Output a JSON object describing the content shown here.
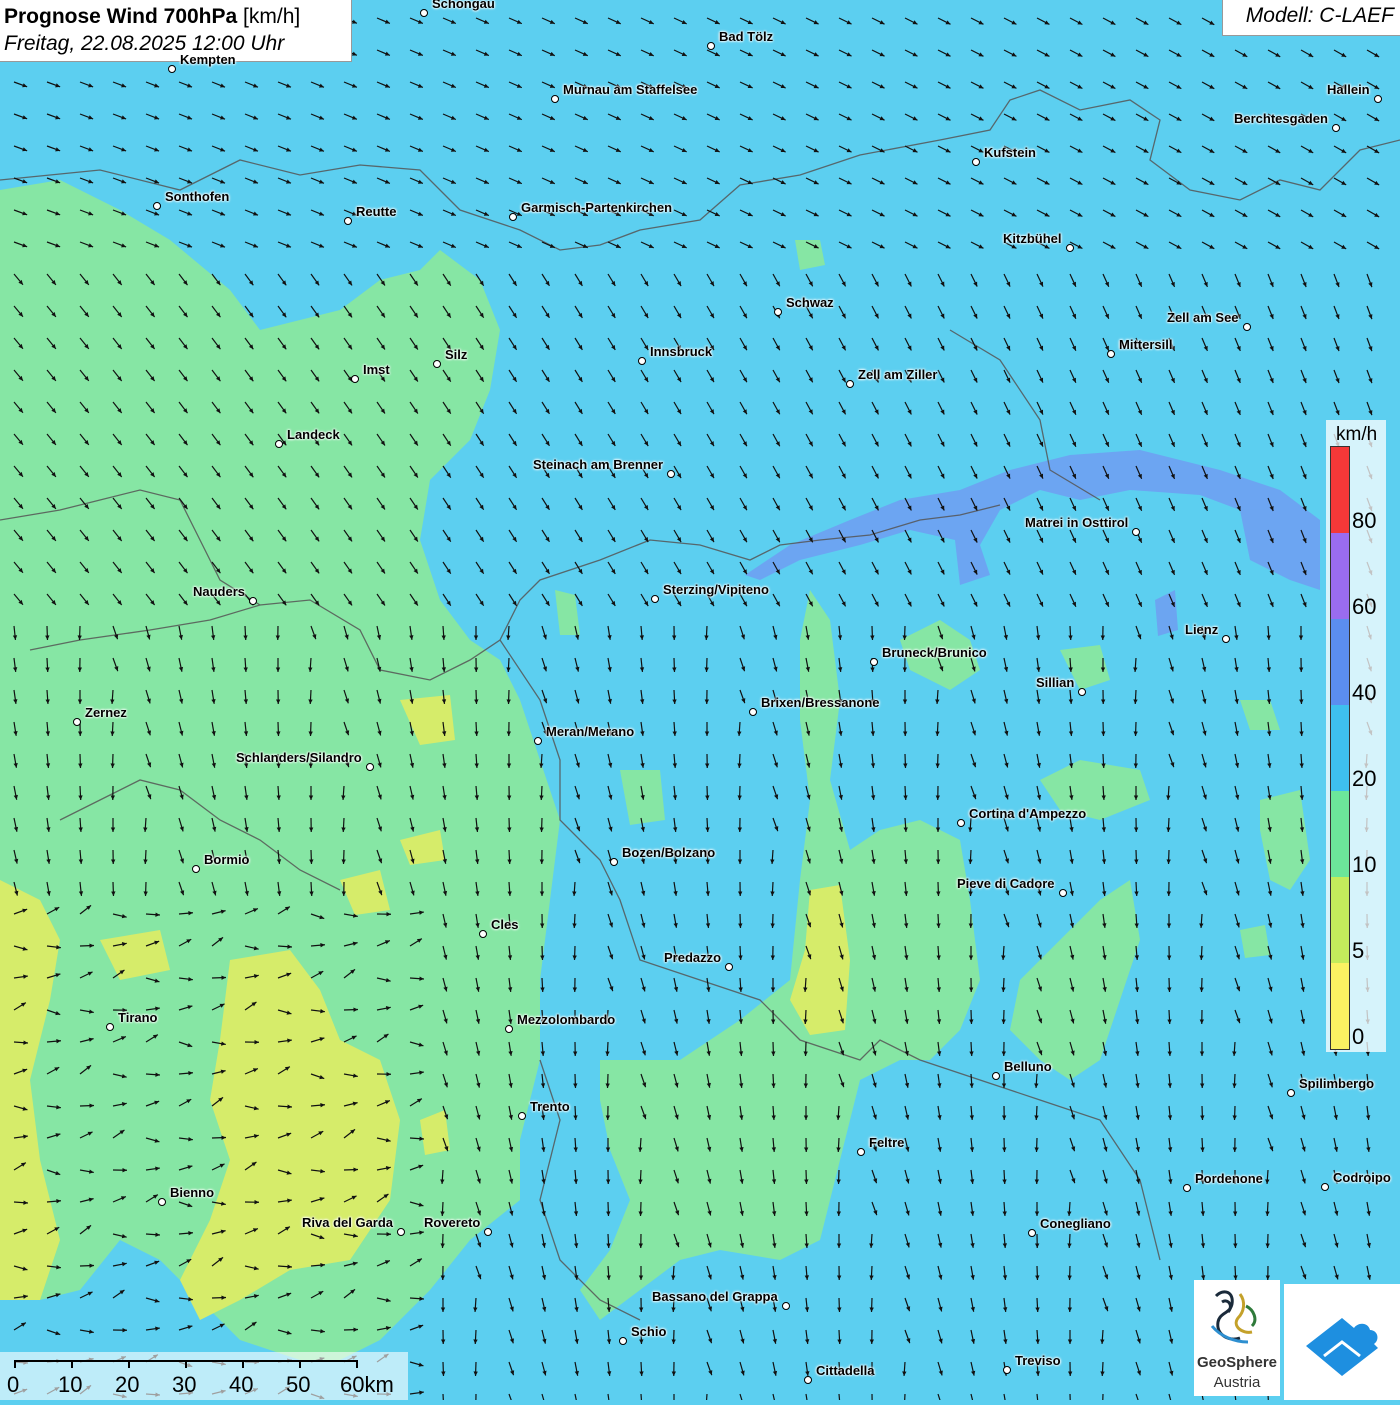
{
  "header": {
    "title": "Prognose Wind 700hPa",
    "unit": "[km/h]",
    "datetime": "Freitag, 22.08.2025 12:00 Uhr",
    "model": "Modell: C-LAEF"
  },
  "legend": {
    "unit": "km/h",
    "ticks": [
      "80",
      "60",
      "40",
      "20",
      "10",
      "5",
      "0"
    ],
    "colors": [
      "#f43838",
      "#9a6cf0",
      "#5b8ef0",
      "#3ec0ee",
      "#6ce69a",
      "#c4ec5c",
      "#fbf262"
    ]
  },
  "scalebar": {
    "labels": [
      "0",
      "10",
      "20",
      "30",
      "40",
      "50",
      "60km"
    ]
  },
  "logos": {
    "geosphere_line1": "GeoSphere",
    "geosphere_line2": "Austria",
    "geosphere_icon": "geosphere-logo-icon",
    "second_icon": "cloud-arrow-logo-icon"
  },
  "palette": {
    "wind_10_20": "#5ccff0",
    "wind_5_10": "#86e6a4",
    "wind_0_5": "#d6ec6a",
    "wind_20_40": "#6f9ef2",
    "borders": "#555555"
  },
  "cities": [
    {
      "name": "Schongau"
    },
    {
      "name": "Bad Tölz"
    },
    {
      "name": "Kempten"
    },
    {
      "name": "Murnau am Staffelsee"
    },
    {
      "name": "Hallein"
    },
    {
      "name": "Berchtesgaden"
    },
    {
      "name": "Kufstein"
    },
    {
      "name": "Sonthofen"
    },
    {
      "name": "Reutte"
    },
    {
      "name": "Garmisch-Partenkirchen"
    },
    {
      "name": "Kitzbühel"
    },
    {
      "name": "Schwaz"
    },
    {
      "name": "Zell am See"
    },
    {
      "name": "Innsbruck"
    },
    {
      "name": "Mittersill"
    },
    {
      "name": "Silz"
    },
    {
      "name": "Imst"
    },
    {
      "name": "Zell am Ziller"
    },
    {
      "name": "Landeck"
    },
    {
      "name": "Steinach am Brenner"
    },
    {
      "name": "Matrei in Osttirol"
    },
    {
      "name": "Nauders"
    },
    {
      "name": "Sterzing/Vipiteno"
    },
    {
      "name": "Lienz"
    },
    {
      "name": "Bruneck/Brunico"
    },
    {
      "name": "Sillian"
    },
    {
      "name": "Brixen/Bressanone"
    },
    {
      "name": "Zernez"
    },
    {
      "name": "Meran/Merano"
    },
    {
      "name": "Schlanders/Silandro"
    },
    {
      "name": "Cortina d'Ampezzo"
    },
    {
      "name": "Bozen/Bolzano"
    },
    {
      "name": "Bormio"
    },
    {
      "name": "Pieve di Cadore"
    },
    {
      "name": "Cles"
    },
    {
      "name": "Predazzo"
    },
    {
      "name": "Tirano"
    },
    {
      "name": "Mezzolombardo"
    },
    {
      "name": "Belluno"
    },
    {
      "name": "Spilimbergo"
    },
    {
      "name": "Trento"
    },
    {
      "name": "Feltre"
    },
    {
      "name": "Pordenone"
    },
    {
      "name": "Codroipo"
    },
    {
      "name": "Bienno"
    },
    {
      "name": "Riva del Garda"
    },
    {
      "name": "Rovereto"
    },
    {
      "name": "Conegliano"
    },
    {
      "name": "Bassano del Grappa"
    },
    {
      "name": "Schio"
    },
    {
      "name": "Treviso"
    },
    {
      "name": "Cittadella"
    }
  ]
}
